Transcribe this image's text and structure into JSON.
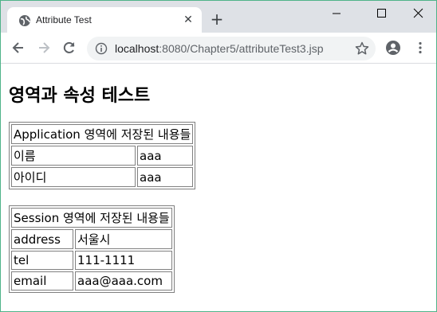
{
  "tab": {
    "title": "Attribute Test",
    "close_glyph": "✕"
  },
  "newtab_glyph": "+",
  "address_bar": {
    "host": "localhost",
    "path": ":8080/Chapter5/attributeTest3.jsp"
  },
  "icons": {
    "favicon": "globe-icon",
    "minimize": "minimize-icon",
    "maximize": "maximize-icon",
    "close": "close-window-icon",
    "back": "back-arrow-icon",
    "forward": "forward-arrow-icon",
    "reload": "reload-icon",
    "info": "info-icon",
    "star": "star-icon",
    "profile": "profile-icon",
    "menu": "kebab-menu-icon"
  },
  "page": {
    "title": "영역과 속성 테스트",
    "application_table": {
      "header": "Application 영역에 저장된 내용들",
      "rows": [
        [
          "이름",
          "aaa"
        ],
        [
          "아이디",
          "aaa"
        ]
      ]
    },
    "session_table": {
      "header": "Session 영역에 저장된 내용들",
      "rows": [
        [
          "address",
          "서울시"
        ],
        [
          "tel",
          "111-1111"
        ],
        [
          "email",
          "aaa@aaa.com"
        ]
      ]
    }
  },
  "colors": {
    "tabstrip": "#dee1e6",
    "omnibox": "#f1f3f4",
    "window_border": "#4fb389"
  }
}
